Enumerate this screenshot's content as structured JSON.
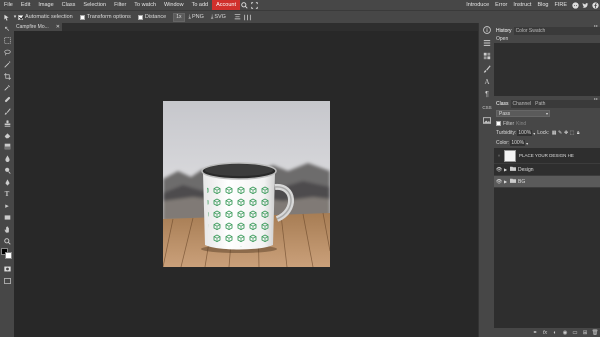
{
  "menubar": {
    "items": [
      "File",
      "Edit",
      "Image",
      "Class",
      "Selection",
      "Filter",
      "To watch",
      "Window",
      "To add"
    ],
    "account": "Account",
    "right_items": [
      "Introduce",
      "Error",
      "Instruct",
      "Blog",
      "FIRE"
    ]
  },
  "options": {
    "automatic_selection": "Automatic selection",
    "transform_options": "Transform options",
    "distance": "Distance",
    "scale_select": "1x",
    "png_label": "PNG",
    "svg_label": "SVG"
  },
  "document": {
    "tab_title": "Campfire Mo..."
  },
  "history_panel": {
    "tabs": [
      "History",
      "Color Swatch"
    ],
    "items": [
      "Open"
    ]
  },
  "layers_panel": {
    "tabs": [
      "Class",
      "Channel",
      "Path"
    ],
    "blend_mode": "Pass",
    "filter_label": "Filter",
    "filter_kind": "Kind",
    "turbidity_label": "Turbidity:",
    "turbidity_value": "100%",
    "lock_label": "Lock:",
    "color_label": "Color:",
    "color_value": "100%",
    "layers": [
      {
        "name": "PLACE YOUR DESIGN HE",
        "type": "smart"
      },
      {
        "name": "Design",
        "type": "folder"
      },
      {
        "name": "BG",
        "type": "folder"
      }
    ]
  },
  "right_strip": {
    "css_label": "CSS"
  },
  "colors": {
    "accent_red": "#d0302c",
    "chrome": "#474747",
    "workspace": "#282828",
    "mug_pattern": "#3a9a5a"
  }
}
